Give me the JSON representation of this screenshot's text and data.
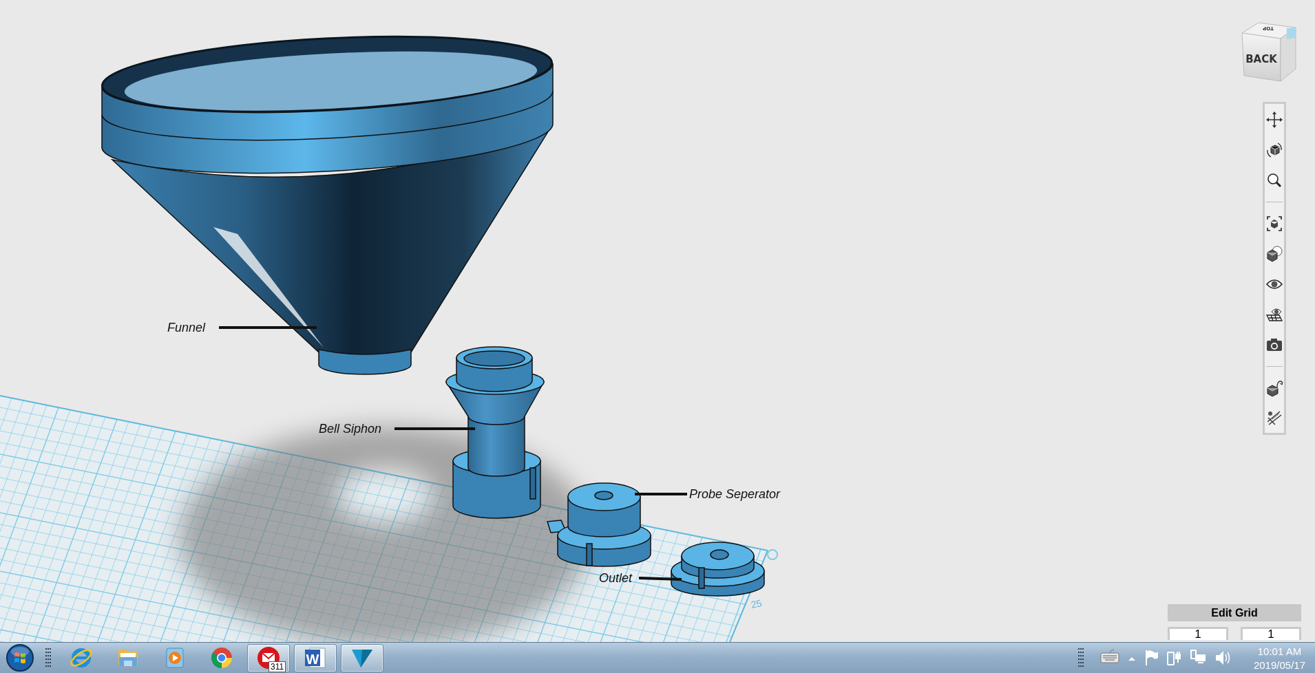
{
  "viewport": {
    "view_cube": {
      "front_label": "BACK",
      "top_label": "TOP"
    },
    "callouts": [
      {
        "text": "Funnel"
      },
      {
        "text": "Bell Siphon"
      },
      {
        "text": "Probe Seperator"
      },
      {
        "text": "Outlet"
      }
    ],
    "grid_labels": [
      "25"
    ],
    "edit_grid": {
      "title": "Edit Grid",
      "fields": [
        {
          "value": "1"
        },
        {
          "value": "1"
        }
      ]
    }
  },
  "taskbar": {
    "apps": [
      {
        "kind": "browser",
        "running": false
      },
      {
        "kind": "folder",
        "running": false
      },
      {
        "kind": "media",
        "running": false
      },
      {
        "kind": "chrome",
        "running": false
      },
      {
        "kind": "mail",
        "running": true,
        "badge": "311"
      },
      {
        "kind": "word",
        "running": true,
        "logo_text": "W"
      },
      {
        "kind": "design",
        "running": true
      }
    ],
    "tray": {
      "time": "10:01 AM",
      "date": "2019/05/17"
    }
  }
}
